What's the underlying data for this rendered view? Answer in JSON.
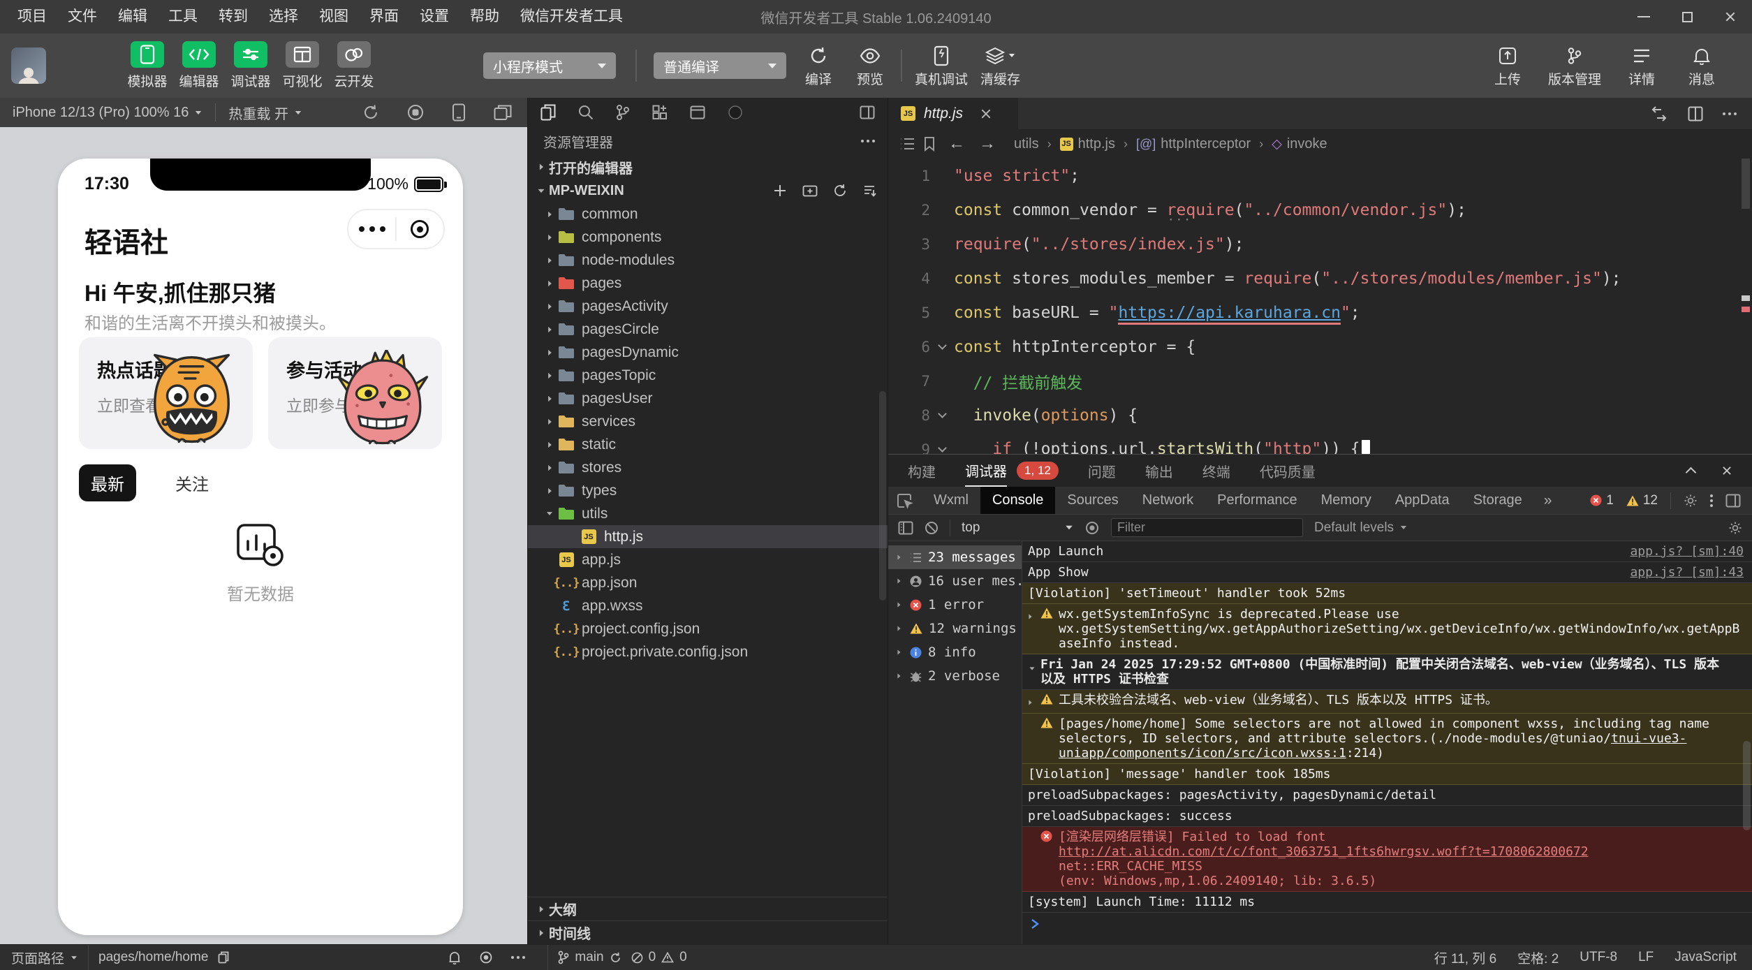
{
  "colors": {
    "brand_green": "#10BF63",
    "titlebar_bg": "#3A3A3A",
    "toolbar_bg": "#464646",
    "panel_bg": "#252526",
    "editor_bg": "#262626",
    "console_bg": "#242424",
    "sim_canvas": "#D2D3D6",
    "warn_bg": "#39331C",
    "warn_border": "#5A5330",
    "error_bg": "#4A1D1D",
    "error_border": "#713030",
    "error_text": "#E57D7D",
    "badge_red": "#D6493E",
    "tab_active_bg": "#0A0A0A",
    "selected_row": "#4A4A4A",
    "code_kw": "#DCC76A",
    "code_str": "#E07A7A",
    "code_fn": "#DCDCAA",
    "code_prm": "#DC9A5E",
    "code_cmt": "#5BB85B",
    "code_link": "#5CA7E0",
    "code_pln": "#D4D4D4"
  },
  "titlebar": {
    "menus": [
      "项目",
      "文件",
      "编辑",
      "工具",
      "转到",
      "选择",
      "视图",
      "界面",
      "设置",
      "帮助",
      "微信开发者工具"
    ],
    "title": "微信开发者工具 Stable 1.06.2409140"
  },
  "toolbar": {
    "main_buttons": [
      {
        "label": "模拟器",
        "name": "simulator-button",
        "icon": "phone",
        "active": true
      },
      {
        "label": "编辑器",
        "name": "editor-button",
        "icon": "code",
        "active": true
      },
      {
        "label": "调试器",
        "name": "debugger-button",
        "icon": "sliders",
        "active": true
      },
      {
        "label": "可视化",
        "name": "visualization-button",
        "icon": "layout",
        "active": false
      },
      {
        "label": "云开发",
        "name": "cloud-dev-button",
        "icon": "cloud",
        "active": false
      }
    ],
    "mode_select": "小程序模式",
    "compile_select": "普通编译",
    "compile_label": "编译",
    "preview_label": "预览",
    "remote_debug_label": "真机调试",
    "clear_cache_label": "清缓存",
    "right_buttons": [
      {
        "label": "上传",
        "name": "upload-button",
        "icon": "upload"
      },
      {
        "label": "版本管理",
        "name": "version-control-button",
        "icon": "branch"
      },
      {
        "label": "详情",
        "name": "details-button",
        "icon": "lines"
      },
      {
        "label": "消息",
        "name": "messages-button",
        "icon": "bell"
      }
    ]
  },
  "simulator": {
    "device_label": "iPhone 12/13 (Pro) 100% 16",
    "hot_reload_label": "热重载 开",
    "phone": {
      "time": "17:30",
      "battery": "100%",
      "app_title": "轻语社",
      "greeting": "Hi 午安,抓住那只猪",
      "subtitle": "和谐的生活离不开摸头和被摸头。",
      "cards": [
        {
          "title": "热点话题",
          "action": "立即查看",
          "monster": "orange"
        },
        {
          "title": "参与活动",
          "action": "立即参与",
          "monster": "pink"
        }
      ],
      "feed_tabs": [
        {
          "label": "最新",
          "active": true
        },
        {
          "label": "关注",
          "active": false
        }
      ],
      "empty_text": "暂无数据"
    }
  },
  "explorer": {
    "title": "资源管理器",
    "open_editors": "打开的编辑器",
    "project": "MP-WEIXIN",
    "items": [
      {
        "label": "common",
        "depth": 1,
        "icon": "folder-gray",
        "arrow": "right"
      },
      {
        "label": "components",
        "depth": 1,
        "icon": "folder-lime",
        "arrow": "right"
      },
      {
        "label": "node-modules",
        "depth": 1,
        "icon": "folder-gray",
        "arrow": "right"
      },
      {
        "label": "pages",
        "depth": 1,
        "icon": "folder-red",
        "arrow": "right"
      },
      {
        "label": "pagesActivity",
        "depth": 1,
        "icon": "folder-gray",
        "arrow": "right"
      },
      {
        "label": "pagesCircle",
        "depth": 1,
        "icon": "folder-gray",
        "arrow": "right"
      },
      {
        "label": "pagesDynamic",
        "depth": 1,
        "icon": "folder-gray",
        "arrow": "right"
      },
      {
        "label": "pagesTopic",
        "depth": 1,
        "icon": "folder-gray",
        "arrow": "right"
      },
      {
        "label": "pagesUser",
        "depth": 1,
        "icon": "folder-gray",
        "arrow": "right"
      },
      {
        "label": "services",
        "depth": 1,
        "icon": "folder-yellow",
        "arrow": "right"
      },
      {
        "label": "static",
        "depth": 1,
        "icon": "folder-yellow",
        "arrow": "right"
      },
      {
        "label": "stores",
        "depth": 1,
        "icon": "folder-gray",
        "arrow": "right"
      },
      {
        "label": "types",
        "depth": 1,
        "icon": "folder-gray",
        "arrow": "right"
      },
      {
        "label": "utils",
        "depth": 1,
        "icon": "folder-green",
        "arrow": "down"
      },
      {
        "label": "http.js",
        "depth": 2,
        "icon": "js",
        "arrow": "none",
        "selected": true
      },
      {
        "label": "app.js",
        "depth": 1,
        "icon": "js",
        "arrow": "none"
      },
      {
        "label": "app.json",
        "depth": 1,
        "icon": "json",
        "arrow": "none"
      },
      {
        "label": "app.wxss",
        "depth": 1,
        "icon": "wxss",
        "arrow": "none"
      },
      {
        "label": "project.config.json",
        "depth": 1,
        "icon": "json",
        "arrow": "none"
      },
      {
        "label": "project.private.config.json",
        "depth": 1,
        "icon": "json",
        "arrow": "none"
      }
    ],
    "outline": "大纲",
    "timeline": "时间线"
  },
  "editor": {
    "tab_file": "http.js",
    "breadcrumb": [
      {
        "label": "utils",
        "icon": "none"
      },
      {
        "label": "http.js",
        "icon": "js"
      },
      {
        "label": "httpInterceptor",
        "icon": "at"
      },
      {
        "label": "invoke",
        "icon": "method"
      }
    ],
    "lines": [
      {
        "num": "1",
        "fold": false,
        "seg": [
          {
            "c": "str",
            "t": "\"use strict\""
          },
          {
            "c": "pln",
            "t": ";"
          }
        ]
      },
      {
        "num": "2",
        "fold": false,
        "seg": [
          {
            "c": "kw",
            "t": "const"
          },
          {
            "c": "pln",
            "t": " common_vendor = "
          },
          {
            "c": "req",
            "t": "require"
          },
          {
            "c": "pln",
            "t": "("
          },
          {
            "c": "str",
            "t": "\"../common/vendor.js\""
          },
          {
            "c": "pln",
            "t": ");"
          }
        ]
      },
      {
        "num": "3",
        "fold": false,
        "seg": [
          {
            "c": "req",
            "t": "require"
          },
          {
            "c": "pln",
            "t": "("
          },
          {
            "c": "str",
            "t": "\"../stores/index.js\""
          },
          {
            "c": "pln",
            "t": ");"
          }
        ]
      },
      {
        "num": "4",
        "fold": false,
        "seg": [
          {
            "c": "kw",
            "t": "const"
          },
          {
            "c": "pln",
            "t": " stores_modules_member = "
          },
          {
            "c": "req",
            "t": "require"
          },
          {
            "c": "pln",
            "t": "("
          },
          {
            "c": "str",
            "t": "\"../stores/modules/member.js\""
          },
          {
            "c": "pln",
            "t": ");"
          }
        ]
      },
      {
        "num": "5",
        "fold": false,
        "seg": [
          {
            "c": "kw",
            "t": "const"
          },
          {
            "c": "pln",
            "t": " baseURL = "
          },
          {
            "c": "str",
            "t": "\""
          },
          {
            "c": "link",
            "t": "https://api.karuhara.cn"
          },
          {
            "c": "str",
            "t": "\""
          },
          {
            "c": "pln",
            "t": ";"
          }
        ]
      },
      {
        "num": "6",
        "fold": true,
        "seg": [
          {
            "c": "kw",
            "t": "const"
          },
          {
            "c": "pln",
            "t": " httpInterceptor = {"
          }
        ]
      },
      {
        "num": "7",
        "fold": false,
        "seg": [
          {
            "c": "cmt",
            "t": "  // 拦截前触发"
          }
        ]
      },
      {
        "num": "8",
        "fold": true,
        "seg": [
          {
            "c": "pln",
            "t": "  "
          },
          {
            "c": "fn",
            "t": "invoke"
          },
          {
            "c": "pln",
            "t": "("
          },
          {
            "c": "prm",
            "t": "options"
          },
          {
            "c": "pln",
            "t": ") {"
          }
        ]
      },
      {
        "num": "9",
        "fold": true,
        "seg": [
          {
            "c": "pln",
            "t": "    "
          },
          {
            "c": "ctl",
            "t": "if"
          },
          {
            "c": "pln",
            "t": " (!options.url."
          },
          {
            "c": "fn",
            "t": "startsWith"
          },
          {
            "c": "pln",
            "t": "("
          },
          {
            "c": "str",
            "t": "\"http\""
          },
          {
            "c": "pln",
            "t": ")) {"
          },
          {
            "c": "cursor",
            "t": ""
          }
        ]
      }
    ]
  },
  "debugger": {
    "tabs": [
      {
        "label": "构建",
        "name": "build"
      },
      {
        "label": "调试器",
        "name": "debugger",
        "active": true,
        "badge": "1, 12"
      },
      {
        "label": "问题",
        "name": "problems"
      },
      {
        "label": "输出",
        "name": "output"
      },
      {
        "label": "终端",
        "name": "terminal"
      },
      {
        "label": "代码质量",
        "name": "code-quality"
      }
    ],
    "devtools_tabs": [
      {
        "label": "Wxml"
      },
      {
        "label": "Console",
        "active": true
      },
      {
        "label": "Sources"
      },
      {
        "label": "Network"
      },
      {
        "label": "Performance"
      },
      {
        "label": "Memory"
      },
      {
        "label": "AppData"
      },
      {
        "label": "Storage"
      }
    ],
    "more_label": "»",
    "error_count": "1",
    "warning_count": "12",
    "filter": {
      "context": "top",
      "placeholder": "Filter",
      "levels": "Default levels"
    },
    "sidebar": [
      {
        "icon": "list",
        "label": "23 messages",
        "selected": true
      },
      {
        "icon": "user",
        "label": "16 user mes..."
      },
      {
        "icon": "error",
        "label": "1 error"
      },
      {
        "icon": "warning",
        "label": "12 warnings"
      },
      {
        "icon": "info",
        "label": "8 info"
      },
      {
        "icon": "verbose",
        "label": "2 verbose"
      }
    ],
    "messages": [
      {
        "kind": "log",
        "parts": [
          {
            "t": "App Launch"
          }
        ],
        "link": "app.js? [sm]:40"
      },
      {
        "kind": "log",
        "parts": [
          {
            "t": "App Show"
          }
        ],
        "link": "app.js? [sm]:43"
      },
      {
        "kind": "viol",
        "parts": [
          {
            "t": "[Violation] 'setTimeout' handler took 52ms"
          }
        ]
      },
      {
        "kind": "warn",
        "caret": "right",
        "parts": [
          {
            "t": "wx.getSystemInfoSync is deprecated.Please use wx.getSystemSetting/wx.getAppAuthorizeSetting/wx.getDeviceInfo/wx.getWindowInfo/wx.getAppBaseInfo instead."
          }
        ]
      },
      {
        "kind": "group",
        "caret": "down",
        "parts": [
          {
            "t": "Fri Jan 24 2025 17:29:52 GMT+0800 (中国标准时间) 配置中关闭合法域名、web-view（业务域名）、TLS 版本\n以及 HTTPS 证书检查"
          }
        ]
      },
      {
        "kind": "warn",
        "caret": "right",
        "parts": [
          {
            "t": "工具未校验合法域名、web-view（业务域名）、TLS 版本以及 HTTPS 证书。"
          }
        ]
      },
      {
        "kind": "warn",
        "parts": [
          {
            "t": "[pages/home/home] Some selectors are not allowed in component wxss, including tag name selectors, ID selectors, and attribute selectors.(./node-modules/@tuniao/"
          },
          {
            "t": "tnui-vue3-uniapp/components/icon/src/icon.wxss:1",
            "link": true
          },
          {
            "t": ":214)"
          }
        ]
      },
      {
        "kind": "viol",
        "parts": [
          {
            "t": "[Violation] 'message' handler took 185ms"
          }
        ]
      },
      {
        "kind": "log",
        "parts": [
          {
            "t": "preloadSubpackages: pagesActivity, pagesDynamic/detail"
          }
        ]
      },
      {
        "kind": "log",
        "parts": [
          {
            "t": "preloadSubpackages: success"
          }
        ]
      },
      {
        "kind": "error",
        "parts": [
          {
            "t": "[渲染层网络层错误] Failed to load font "
          },
          {
            "t": "http://at.alicdn.com/t/c/font_3063751_1fts6hwrgsv.woff?t=1708062800672",
            "link": true
          },
          {
            "t": "\nnet::ERR_CACHE_MISS\n(env: Windows,mp,1.06.2409140; lib: 3.6.5)"
          }
        ]
      },
      {
        "kind": "log",
        "parts": [
          {
            "t": "[system] Launch Time: 11112 ms"
          }
        ]
      }
    ]
  },
  "statusbar": {
    "page_path_label": "页面路径",
    "page_path": "pages/home/home",
    "branch": "main",
    "error_count": "0",
    "warning_count": "0",
    "right_items": [
      {
        "name": "line-col",
        "label": "行 11, 列 6"
      },
      {
        "name": "indent",
        "label": "空格: 2"
      },
      {
        "name": "encoding",
        "label": "UTF-8"
      },
      {
        "name": "eol",
        "label": "LF"
      },
      {
        "name": "language",
        "label": "JavaScript"
      }
    ]
  }
}
